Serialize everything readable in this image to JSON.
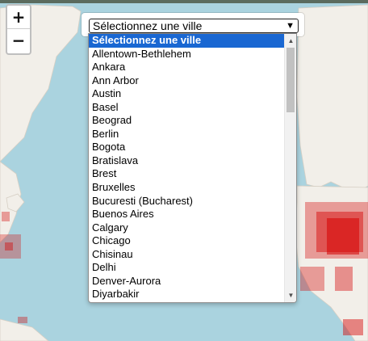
{
  "map": {
    "colors": {
      "water": "#aad3df",
      "land": "#f2efe9",
      "density": "#d50000"
    }
  },
  "zoom": {
    "in_label": "+",
    "out_label": "−"
  },
  "city_select": {
    "selected": "Sélectionnez une ville",
    "arrow": "chevron-down-icon",
    "options": [
      "Sélectionnez une ville",
      "Allentown-Bethlehem",
      "Ankara",
      "Ann Arbor",
      "Austin",
      "Basel",
      "Beograd",
      "Berlin",
      "Bogota",
      "Bratislava",
      "Brest",
      "Bruxelles",
      "Bucuresti (Bucharest)",
      "Buenos Aires",
      "Calgary",
      "Chicago",
      "Chisinau",
      "Delhi",
      "Denver-Aurora",
      "Diyarbakir"
    ],
    "selected_index": 0
  }
}
